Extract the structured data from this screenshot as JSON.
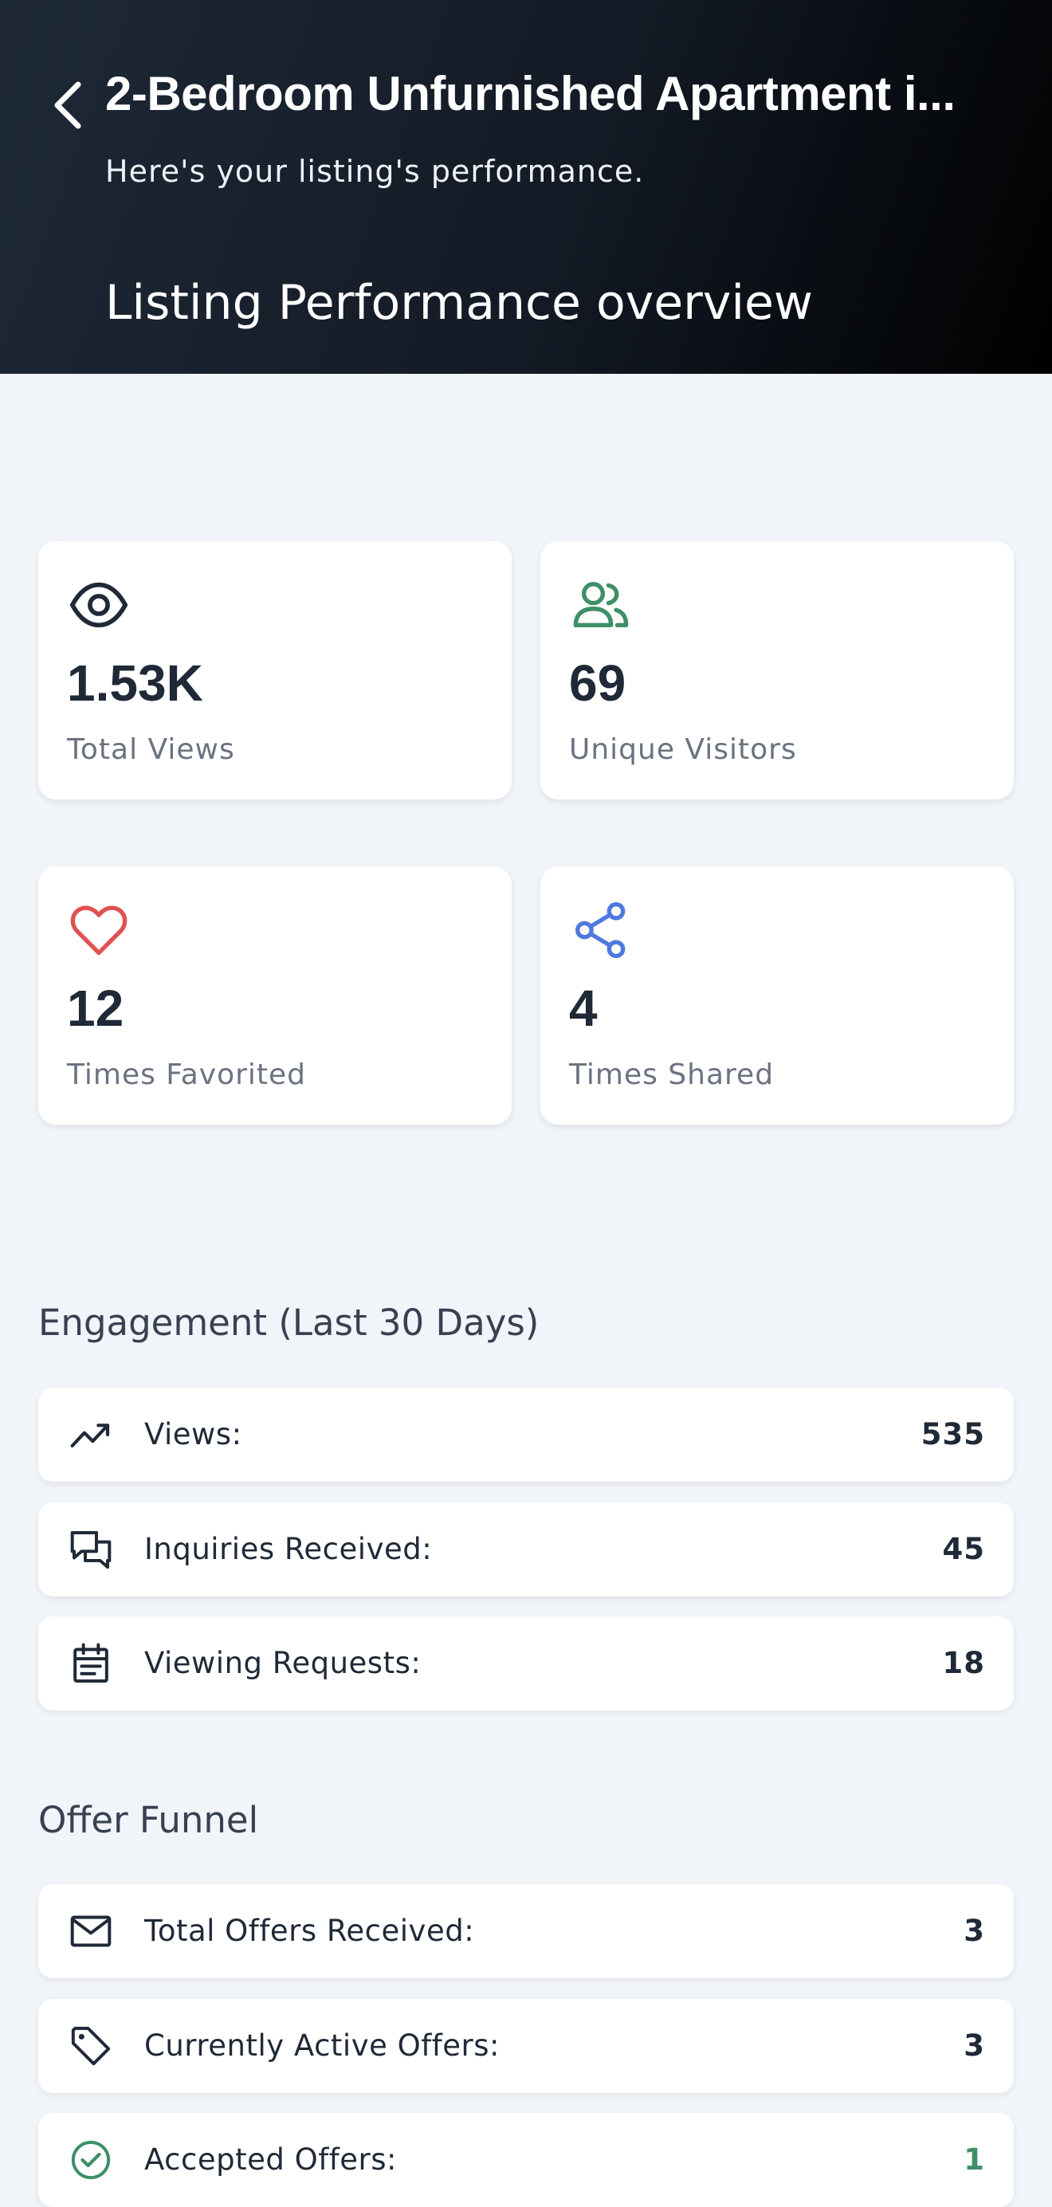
{
  "header": {
    "title": "2-Bedroom Unfurnished Apartment i...",
    "subtitle": "Here's your listing's performance.",
    "section_title": "Listing Performance overview"
  },
  "stats": [
    {
      "icon": "eye-icon",
      "value": "1.53K",
      "label": "Total Views",
      "color": "#1f2937"
    },
    {
      "icon": "users-icon",
      "value": "69",
      "label": "Unique Visitors",
      "color": "#3f8f68"
    },
    {
      "icon": "heart-icon",
      "value": "12",
      "label": "Times Favorited",
      "color": "#e05252"
    },
    {
      "icon": "share-icon",
      "value": "4",
      "label": "Times Shared",
      "color": "#4f79e0"
    }
  ],
  "engagement": {
    "heading": "Engagement (Last 30 Days)",
    "rows": [
      {
        "icon": "trending-up-icon",
        "label": "Views:",
        "value": "535"
      },
      {
        "icon": "chat-bubbles-icon",
        "label": "Inquiries Received:",
        "value": "45"
      },
      {
        "icon": "calendar-icon",
        "label": "Viewing Requests:",
        "value": "18"
      }
    ]
  },
  "offer_funnel": {
    "heading": "Offer Funnel",
    "rows": [
      {
        "icon": "mail-icon",
        "label": "Total Offers Received:",
        "value": "3"
      },
      {
        "icon": "tag-icon",
        "label": "Currently Active Offers:",
        "value": "3"
      },
      {
        "icon": "check-circle-icon",
        "label": "Accepted Offers:",
        "value": "1",
        "value_color": "#3f8f68"
      }
    ]
  }
}
